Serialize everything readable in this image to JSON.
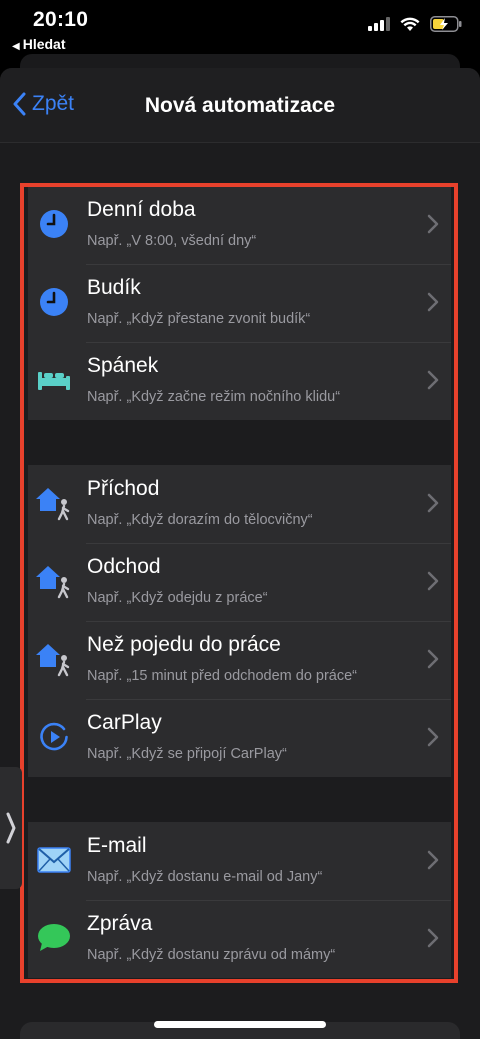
{
  "status": {
    "time": "20:10",
    "back_app": "Hledat"
  },
  "nav": {
    "back_label": "Zpět",
    "title": "Nová automatizace"
  },
  "groups": [
    {
      "items": [
        {
          "icon": "clock-icon",
          "title": "Denní doba",
          "subtitle": "Např. „V 8:00, všední dny“"
        },
        {
          "icon": "alarm-clock-icon",
          "title": "Budík",
          "subtitle": "Např. „Když přestane zvonit budík“"
        },
        {
          "icon": "bed-icon",
          "title": "Spánek",
          "subtitle": "Např. „Když začne režim nočního klidu“"
        }
      ]
    },
    {
      "items": [
        {
          "icon": "house-person-icon",
          "title": "Příchod",
          "subtitle": "Např. „Když dorazím do tělocvičny“"
        },
        {
          "icon": "house-person-icon",
          "title": "Odchod",
          "subtitle": "Např. „Když odejdu z práce“"
        },
        {
          "icon": "house-person-icon",
          "title": "Než pojedu do práce",
          "subtitle": "Např. „15 minut před odchodem do práce“"
        },
        {
          "icon": "carplay-icon",
          "title": "CarPlay",
          "subtitle": "Např. „Když se připojí CarPlay“"
        }
      ]
    },
    {
      "items": [
        {
          "icon": "mail-icon",
          "title": "E-mail",
          "subtitle": "Např. „Když dostanu e-mail od Jany“"
        },
        {
          "icon": "message-icon",
          "title": "Zpráva",
          "subtitle": "Např. „Když dostanu zprávu od mámy“"
        }
      ]
    }
  ],
  "colors": {
    "accent": "#3b82f6",
    "highlight": "#e8412c",
    "teal": "#5ad0c8",
    "green": "#34c759"
  }
}
